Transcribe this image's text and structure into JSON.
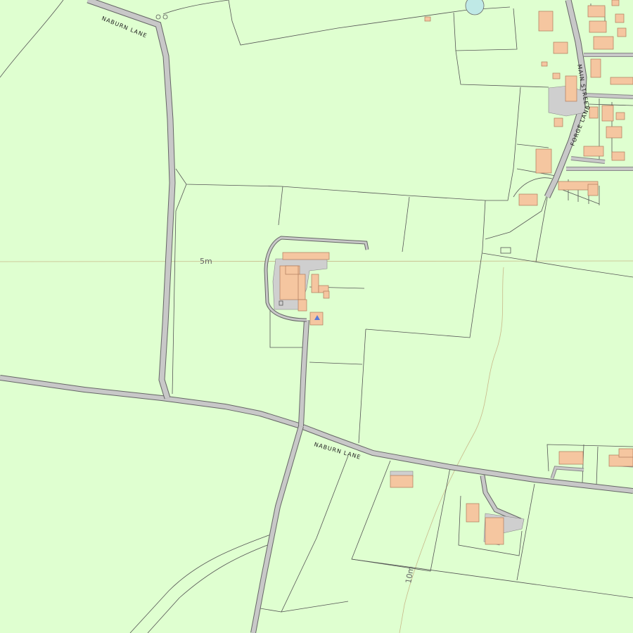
{
  "map": {
    "colors": {
      "land": "#dfffd0",
      "road": "#c8c8c8",
      "road_edge": "#666666",
      "building": "#f5c6a0",
      "building_edge": "#b07a5a",
      "water": "#bfe9e6",
      "field_boundary": "#555555",
      "contour": "#c8b98a"
    },
    "labels": {
      "naburn_lane_north": "NABURN LANE",
      "naburn_lane_south": "NABURN LANE",
      "main_street": "MAIN STREET",
      "forge_lane": "FORGE LANE",
      "contour_5m": "5m",
      "contour_10m": "10m"
    }
  }
}
